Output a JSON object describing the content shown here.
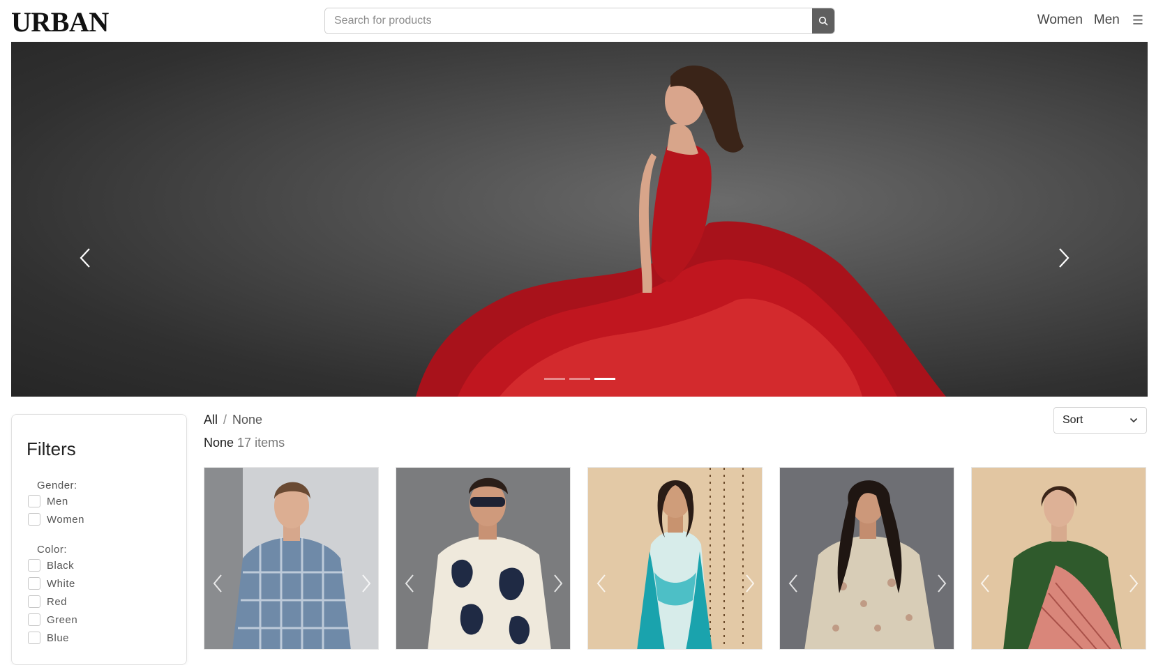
{
  "header": {
    "logo": "URBAN",
    "search": {
      "placeholder": "Search for products",
      "value": ""
    },
    "nav": {
      "women": "Women",
      "men": "Men"
    }
  },
  "hero": {
    "slide_count": 3,
    "active_slide": 3
  },
  "filters": {
    "title": "Filters",
    "gender": {
      "label": "Gender:",
      "options": [
        "Men",
        "Women"
      ]
    },
    "color": {
      "label": "Color:",
      "options": [
        "Black",
        "White",
        "Red",
        "Green",
        "Blue"
      ]
    }
  },
  "listing": {
    "breadcrumb": {
      "root": "All",
      "separator": "/",
      "current": "None"
    },
    "category": "None",
    "count_text": "17 items",
    "sort_label": "Sort"
  },
  "products": [
    {
      "image": "man-checked-shirt"
    },
    {
      "image": "man-printed-shirt-sunglasses"
    },
    {
      "image": "woman-teal-dupatta"
    },
    {
      "image": "woman-embroidered-kurta"
    },
    {
      "image": "woman-green-saree"
    }
  ],
  "colors": {
    "accent": "#5f5f5f",
    "hero_dress": "#c0161f"
  }
}
